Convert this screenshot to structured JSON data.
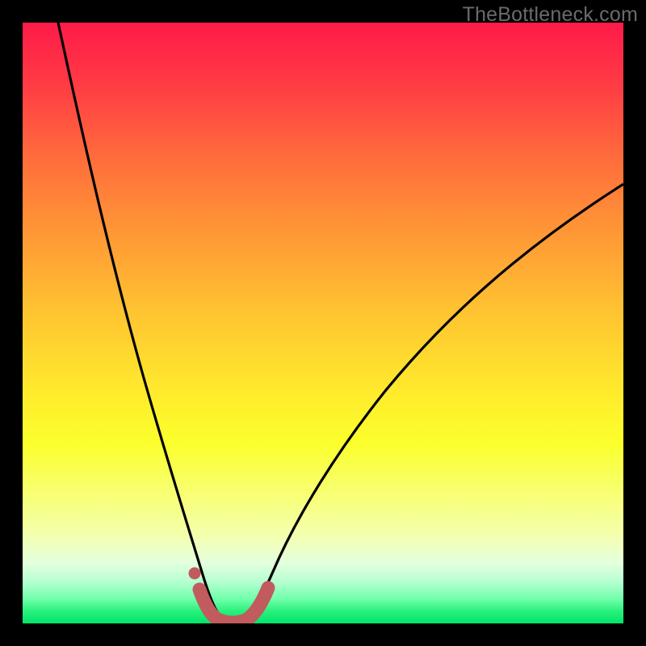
{
  "watermark": "TheBottleneck.com",
  "colors": {
    "curve_stroke": "#000000",
    "marker_stroke": "#c15b5e",
    "marker_fill": "#c15b5e"
  },
  "chart_data": {
    "type": "line",
    "title": "",
    "xlabel": "",
    "ylabel": "",
    "xlim": [
      0,
      100
    ],
    "ylim": [
      0,
      100
    ],
    "series": [
      {
        "name": "bottleneck-curve",
        "x": [
          6,
          8,
          10,
          12,
          14,
          16,
          18,
          20,
          22,
          24,
          26,
          28,
          29,
          30,
          31,
          32,
          33,
          34,
          35,
          36,
          37,
          38,
          40,
          44,
          48,
          52,
          56,
          60,
          64,
          68,
          72,
          76,
          80,
          84,
          88,
          92,
          96,
          100
        ],
        "y": [
          100,
          91,
          82,
          74,
          67,
          60,
          53,
          46,
          40,
          33,
          26,
          18,
          13,
          8,
          4,
          2,
          1,
          1,
          2,
          4,
          7,
          10,
          15,
          23,
          30,
          36,
          41,
          46,
          50,
          54,
          57,
          60,
          63,
          66,
          68,
          70,
          72,
          74
        ]
      }
    ],
    "highlight": {
      "name": "bottom-segment",
      "x": [
        29,
        30,
        31,
        32,
        33,
        34,
        35,
        36,
        37
      ],
      "y": [
        12,
        7,
        3,
        2,
        1,
        1,
        2,
        4,
        7
      ]
    },
    "marker_dot": {
      "x": 28.5,
      "y": 15
    }
  }
}
